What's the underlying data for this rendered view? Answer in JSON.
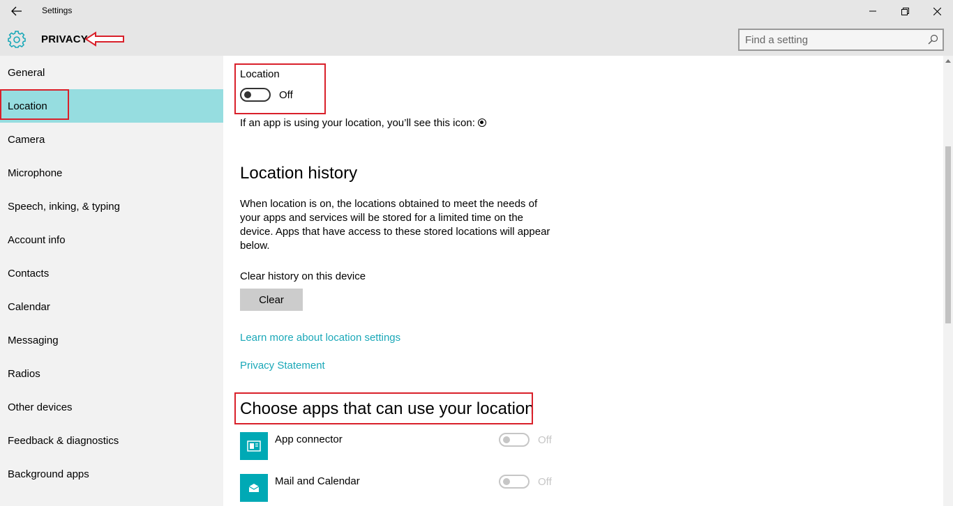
{
  "window": {
    "title": "Settings"
  },
  "header": {
    "section": "PRIVACY",
    "search_placeholder": "Find a setting"
  },
  "sidebar": {
    "items": [
      {
        "label": "General"
      },
      {
        "label": "Location",
        "active": true
      },
      {
        "label": "Camera"
      },
      {
        "label": "Microphone"
      },
      {
        "label": "Speech, inking, & typing"
      },
      {
        "label": "Account info"
      },
      {
        "label": "Contacts"
      },
      {
        "label": "Calendar"
      },
      {
        "label": "Messaging"
      },
      {
        "label": "Radios"
      },
      {
        "label": "Other devices"
      },
      {
        "label": "Feedback & diagnostics"
      },
      {
        "label": "Background apps"
      }
    ]
  },
  "location": {
    "label": "Location",
    "toggle_state": "Off",
    "icon_note": "If an app is using your location, you’ll see this icon:"
  },
  "history": {
    "heading": "Location history",
    "description": "When location is on, the locations obtained to meet the needs of your apps and services will be stored for a limited time on the device. Apps that have access to these stored locations will appear below.",
    "clear_label": "Clear history on this device",
    "clear_button": "Clear"
  },
  "links": {
    "learn_more": "Learn more about location settings",
    "privacy_statement": "Privacy Statement"
  },
  "apps": {
    "heading": "Choose apps that can use your location",
    "items": [
      {
        "name": "App connector",
        "state": "Off",
        "icon": "app-connector-icon"
      },
      {
        "name": "Mail and Calendar",
        "state": "Off",
        "icon": "mail-icon"
      }
    ]
  },
  "colors": {
    "accent": "#00a9b5",
    "active_nav": "#96dde0",
    "link": "#1aa8b8",
    "annotation": "#d9202a"
  }
}
